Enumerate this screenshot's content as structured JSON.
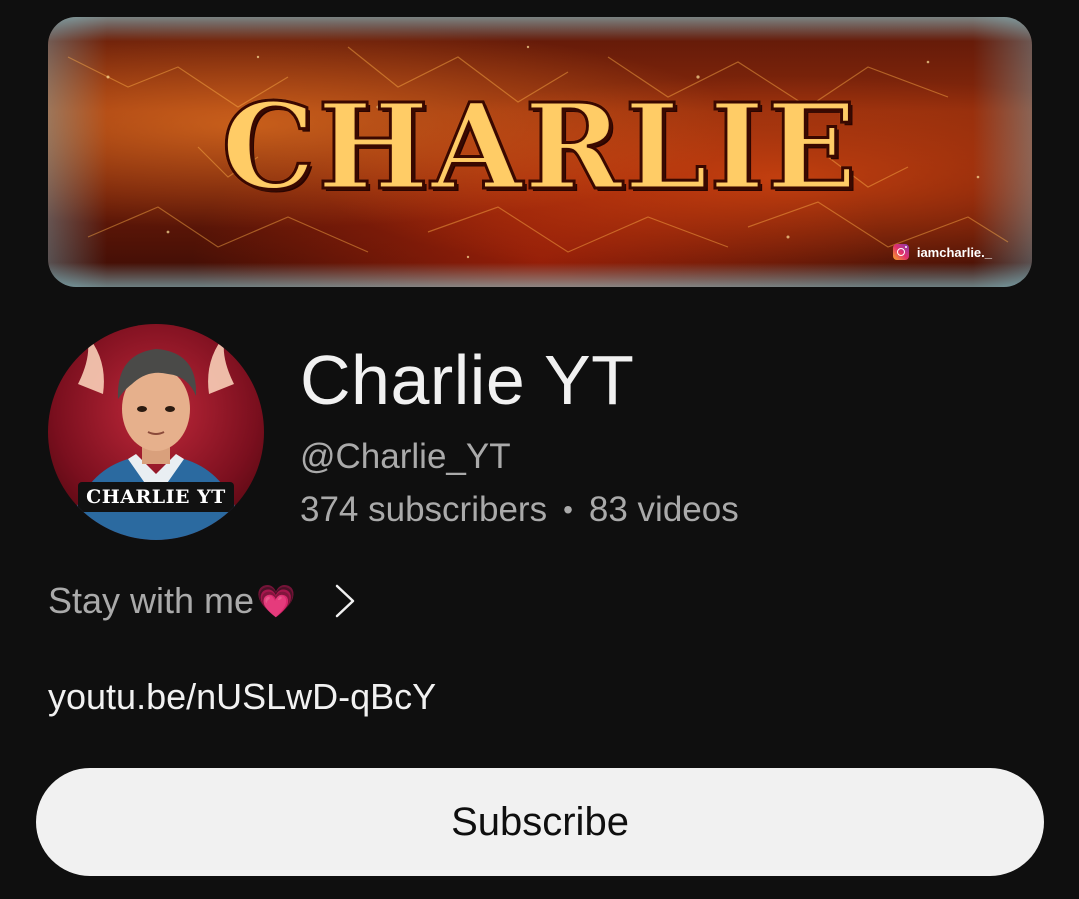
{
  "banner": {
    "title": "CHARLIE",
    "instagram_handle": "iamcharlie._"
  },
  "channel": {
    "avatar_label": "CHARLIE YT",
    "name": "Charlie YT",
    "handle": "@Charlie_YT",
    "subscribers": "374 subscribers",
    "separator": "•",
    "videos": "83 videos"
  },
  "description": {
    "text": "Stay with me",
    "emoji": "💗"
  },
  "link": {
    "text": "youtu.be/nUSLwD-qBcY"
  },
  "subscribe": {
    "label": "Subscribe"
  },
  "icons": {
    "instagram": "instagram-icon",
    "chevron": "chevron-right-icon"
  },
  "colors": {
    "background": "#0f0f0f",
    "primary_text": "#f1f1f1",
    "secondary_text": "#aaaaaa",
    "button_bg": "#f1f1f1",
    "banner_accent": "#ff7a1a"
  }
}
